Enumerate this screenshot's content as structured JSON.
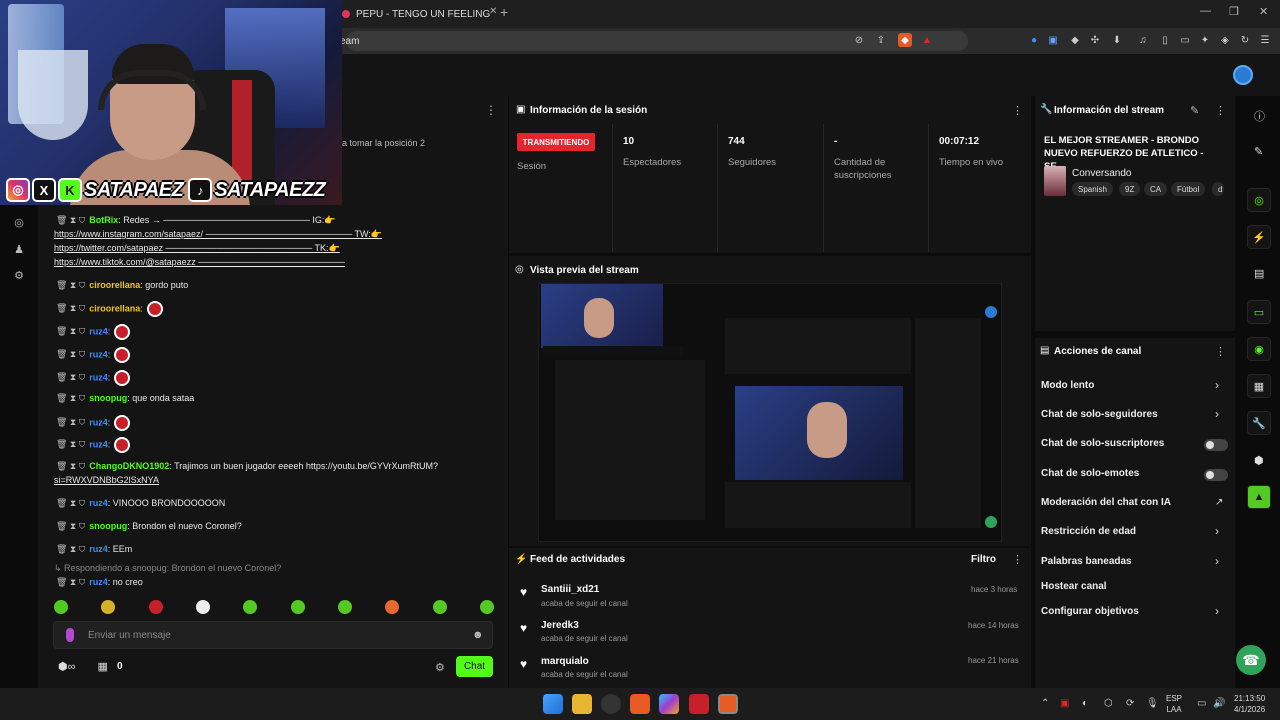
{
  "browser": {
    "tab_title": "PEPU - TENGO UN FEELING (Visualizer)",
    "address": "eam"
  },
  "overlay": {
    "handle_kick": "SATAPAEZ",
    "handle_tiktok": "SATAPAEZZ"
  },
  "chat": {
    "pinned_text": "a tomar la posición 2",
    "messages": [
      {
        "user": "BotRix",
        "color": "#53fc18",
        "text": ": Redes → ─────────────────────── IG:👉"
      },
      {
        "user": "",
        "color": "",
        "text": "https://www.instagram.com/satapaez/ ─────────────────────── TW:👉"
      },
      {
        "user": "",
        "color": "",
        "text": "https://twitter.com/satapaez ─────────────────────── TK:👉"
      },
      {
        "user": "",
        "color": "",
        "text": "https://www.tiktok.com/@satapaezz ───────────────────────"
      },
      {
        "user": "ciroorellana",
        "color": "#f0c419",
        "text": ": gordo puto"
      },
      {
        "user": "ciroorellana",
        "color": "#f0c419",
        "text": ":"
      },
      {
        "user": "ruz4",
        "color": "#3f8cff",
        "text": ":"
      },
      {
        "user": "ruz4",
        "color": "#3f8cff",
        "text": ":"
      },
      {
        "user": "ruz4",
        "color": "#3f8cff",
        "text": ":"
      },
      {
        "user": "snoopug",
        "color": "#53fc18",
        "text": ": que onda sataa"
      },
      {
        "user": "ruz4",
        "color": "#3f8cff",
        "text": ":"
      },
      {
        "user": "ruz4",
        "color": "#3f8cff",
        "text": ":"
      },
      {
        "user": "ChangoDKNO1902",
        "color": "#53fc18",
        "text": ": Trajimos un buen jugador eeeeh https://youtu.be/GYVrXumRtUM?"
      },
      {
        "user": "",
        "color": "",
        "text": "si=RWXVDNBbG2lSxNYA"
      },
      {
        "user": "ruz4",
        "color": "#3f8cff",
        "text": ": VINOOO BRONDOOOOON"
      },
      {
        "user": "snoopug",
        "color": "#53fc18",
        "text": ": Brondon el nuevo Coronel?"
      },
      {
        "user": "ruz4",
        "color": "#3f8cff",
        "text": ": EEm"
      },
      {
        "user": "",
        "color": "",
        "text": "↳ Respondiendo a snoopug: Brondon el nuevo Coronel?"
      },
      {
        "user": "ruz4",
        "color": "#3f8cff",
        "text": ": no creo"
      }
    ],
    "input_placeholder": "Enviar un mensaje",
    "viewer_count": "0",
    "chat_button": "Chat"
  },
  "session": {
    "title": "Información de la sesión",
    "live_badge": "TRANSMITIENDO",
    "status_label": "Sesión",
    "stats": [
      {
        "value": "10",
        "label": "Espectadores"
      },
      {
        "value": "744",
        "label": "Seguidores"
      },
      {
        "value": "-",
        "label": "Cantidad de suscripciones"
      },
      {
        "value": "00:07:12",
        "label": "Tiempo en vivo"
      }
    ]
  },
  "stream_info": {
    "title": "Información del stream",
    "stream_title": "EL MEJOR STREAMER - BRONDO NUEVO REFUERZO DE ATLETICO - SE...",
    "category": "Conversando",
    "tags": [
      "Spanish",
      "9Z",
      "CA",
      "Fútbol",
      "d"
    ]
  },
  "preview": {
    "title": "Vista previa del stream"
  },
  "feed": {
    "title": "Feed de actividades",
    "filter": "Filtro",
    "items": [
      {
        "name": "Santiii_xd21",
        "action": "acaba de seguir el canal",
        "time": "hace 3 horas"
      },
      {
        "name": "Jeredk3",
        "action": "acaba de seguir el canal",
        "time": "hace 14 horas"
      },
      {
        "name": "marquialo",
        "action": "acaba de seguir el canal",
        "time": "hace 21 horas"
      }
    ]
  },
  "actions": {
    "title": "Acciones de canal",
    "items": [
      {
        "label": "Modo lento",
        "control": "chevron"
      },
      {
        "label": "Chat de solo-seguidores",
        "control": "chevron"
      },
      {
        "label": "Chat de solo-suscriptores",
        "control": "toggle"
      },
      {
        "label": "Chat de solo-emotes",
        "control": "toggle"
      },
      {
        "label": "Moderación del chat con IA",
        "control": "external"
      },
      {
        "label": "Restricción de edad",
        "control": "chevron"
      },
      {
        "label": "Palabras baneadas",
        "control": "chevron"
      },
      {
        "label": "Hostear canal",
        "control": "none"
      },
      {
        "label": "Configurar objetivos",
        "control": "chevron"
      }
    ]
  },
  "taskbar": {
    "lang_top": "ESP",
    "lang_bottom": "LAA",
    "time": "21:13:50",
    "date": "4/1/2026"
  },
  "colors": {
    "accent": "#53fc18",
    "live": "#e5242c",
    "panel": "#141414"
  }
}
